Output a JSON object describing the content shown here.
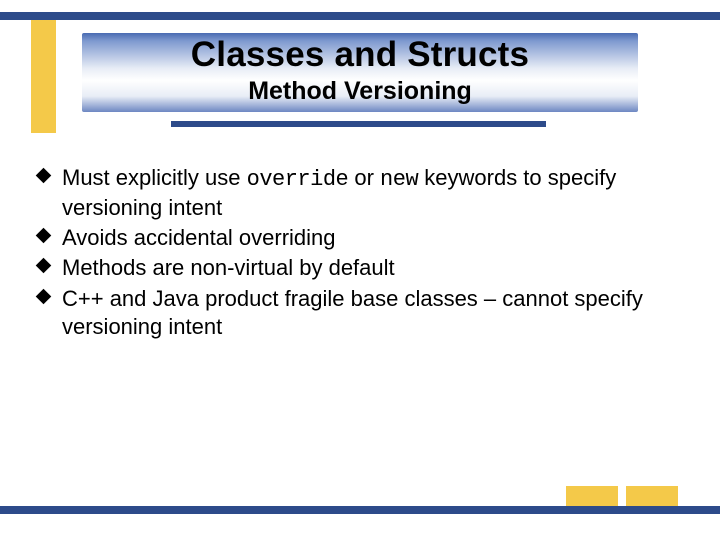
{
  "header": {
    "title": "Classes and Structs",
    "subtitle": "Method Versioning"
  },
  "bullets": [
    {
      "pre": "Must explicitly use ",
      "c1": "override",
      "mid": " or ",
      "c2": "new",
      "post": " keywords to specify versioning intent"
    },
    {
      "text": "Avoids accidental overriding"
    },
    {
      "text": "Methods are non-virtual by default"
    },
    {
      "text": "C++ and Java product fragile base classes – cannot specify versioning intent"
    }
  ],
  "colors": {
    "navy": "#2d4b8a",
    "gold": "#f4c949"
  }
}
